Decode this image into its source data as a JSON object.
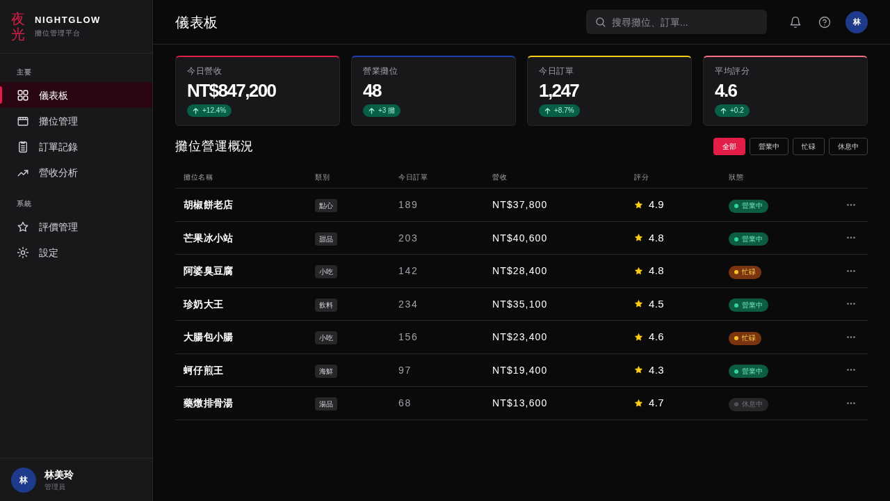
{
  "sidebar": {
    "logo_mark": "夜光",
    "brand": "NIGHTGLOW",
    "tagline": "攤位管理平台",
    "sections": [
      {
        "label": "主要",
        "items": [
          {
            "label": "儀表板",
            "selected": true
          },
          {
            "label": "攤位管理",
            "selected": false
          },
          {
            "label": "訂單記錄",
            "selected": false
          },
          {
            "label": "營收分析",
            "selected": false
          }
        ]
      },
      {
        "label": "系統",
        "items": [
          {
            "label": "評價管理",
            "selected": false
          },
          {
            "label": "設定",
            "selected": false
          }
        ]
      }
    ],
    "user": {
      "avatar": "林",
      "name": "林美玲",
      "role": "管理員"
    }
  },
  "header": {
    "title": "儀表板",
    "search": {
      "placeholder": "搜尋攤位、訂單..."
    },
    "avatar": "林"
  },
  "stats": [
    {
      "label": "今日營收",
      "value": "NT$847,200",
      "change": "+12.4%",
      "color": "#e11d48"
    },
    {
      "label": "營業攤位",
      "value": "48",
      "change": "+3 攤",
      "color": "#1e40af"
    },
    {
      "label": "今日訂單",
      "value": "1,247",
      "change": "+8.7%",
      "color": "#facc15"
    },
    {
      "label": "平均評分",
      "value": "4.6",
      "change": "+0.2",
      "color": "#fb7185"
    }
  ],
  "stalls": {
    "title": "攤位營運概況",
    "filters": [
      {
        "label": "全部",
        "selected": true
      },
      {
        "label": "營業中",
        "selected": false
      },
      {
        "label": "忙碌",
        "selected": false
      },
      {
        "label": "休息中",
        "selected": false
      }
    ],
    "table": {
      "columns": [
        "攤位名稱",
        "類別",
        "今日訂單",
        "營收",
        "評分",
        "狀態"
      ],
      "rows": [
        {
          "name": "胡椒餅老店",
          "category": "點心",
          "orders": "189",
          "revenue": "NT$37,800",
          "rating": "4.9",
          "status": {
            "label": "營業中",
            "kind": "open"
          }
        },
        {
          "name": "芒果冰小站",
          "category": "甜品",
          "orders": "203",
          "revenue": "NT$40,600",
          "rating": "4.8",
          "status": {
            "label": "營業中",
            "kind": "open"
          }
        },
        {
          "name": "阿婆臭豆腐",
          "category": "小吃",
          "orders": "142",
          "revenue": "NT$28,400",
          "rating": "4.8",
          "status": {
            "label": "忙碌",
            "kind": "busy"
          }
        },
        {
          "name": "珍奶大王",
          "category": "飲料",
          "orders": "234",
          "revenue": "NT$35,100",
          "rating": "4.5",
          "status": {
            "label": "營業中",
            "kind": "open"
          }
        },
        {
          "name": "大腸包小腸",
          "category": "小吃",
          "orders": "156",
          "revenue": "NT$23,400",
          "rating": "4.6",
          "status": {
            "label": "忙碌",
            "kind": "busy"
          }
        },
        {
          "name": "蚵仔煎王",
          "category": "海鮮",
          "orders": "97",
          "revenue": "NT$19,400",
          "rating": "4.3",
          "status": {
            "label": "營業中",
            "kind": "open"
          }
        },
        {
          "name": "藥燉排骨湯",
          "category": "湯品",
          "orders": "68",
          "revenue": "NT$13,600",
          "rating": "4.7",
          "status": {
            "label": "休息中",
            "kind": "resting"
          }
        }
      ]
    }
  }
}
